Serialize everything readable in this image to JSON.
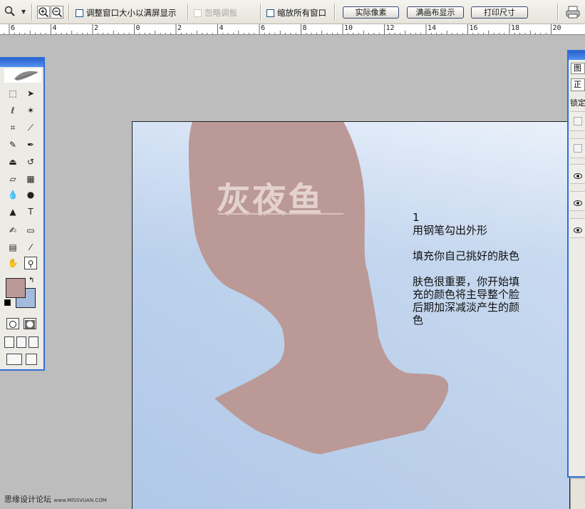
{
  "options_bar": {
    "tool_icon": "zoom-icon",
    "zoom_in_glyph": "+",
    "zoom_out_glyph": "−",
    "resize_windows_label": "调整窗口大小以满屏显示",
    "ignore_palettes_label": "忽略调板",
    "zoom_all_windows_label": "缩放所有窗口",
    "actual_pixels_label": "实际像素",
    "fit_screen_label": "满画布显示",
    "print_size_label": "打印尺寸"
  },
  "ruler": {
    "labels": [
      "6",
      "4",
      "2",
      "0",
      "2",
      "4",
      "6",
      "8",
      "10",
      "12",
      "14",
      "16",
      "18",
      "20"
    ]
  },
  "canvas": {
    "watermark": "灰夜鱼",
    "annotations": [
      "1",
      "用钢笔勾出外形",
      "",
      "填充你自己挑好的肤色",
      "",
      "肤色很重要，你开始填",
      "充的颜色将主导整个脸",
      "后期加深减淡产生的颜",
      "色"
    ]
  },
  "toolbox": {
    "foreground_color": "#bb9996",
    "background_color": "#a3bbdc",
    "tools": [
      "marquee-icon",
      "move-icon",
      "lasso-icon",
      "magic-wand-icon",
      "crop-icon",
      "slice-icon",
      "healing-brush-icon",
      "brush-icon",
      "clone-stamp-icon",
      "history-brush-icon",
      "eraser-icon",
      "gradient-icon",
      "blur-icon",
      "dodge-icon",
      "path-selection-icon",
      "type-icon",
      "pen-icon",
      "shape-icon",
      "notes-icon",
      "eyedropper-icon",
      "hand-icon",
      "zoom-icon"
    ],
    "type_glyph": "T"
  },
  "layers_panel": {
    "tab_label": "图",
    "blend_mode": "正",
    "lock_label": "锁定"
  },
  "credit": {
    "text": "思缘设计论坛",
    "url": "www.MISSVUAN.COM"
  },
  "colors": {
    "skin": "#bb9996",
    "canvas_bg": "#c3d6ee",
    "title_blue": "#2f6fd6"
  }
}
